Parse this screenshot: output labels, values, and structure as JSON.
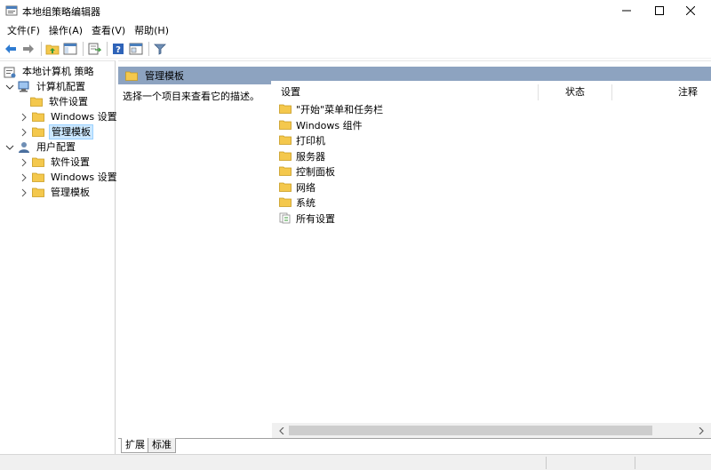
{
  "window": {
    "title": "本地组策略编辑器",
    "icons": {
      "app": "policy-editor-icon",
      "minimize": "minimize-icon",
      "maximize": "maximize-icon",
      "close": "close-icon"
    }
  },
  "menu": {
    "items": [
      {
        "label": "文件(F)"
      },
      {
        "label": "操作(A)"
      },
      {
        "label": "查看(V)"
      },
      {
        "label": "帮助(H)"
      }
    ]
  },
  "toolbar": {
    "buttons": [
      "back-arrow-icon",
      "forward-arrow-icon",
      "up-folder-icon",
      "show-hide-tree-icon",
      "export-list-icon",
      "help-icon",
      "properties-icon",
      "filter-icon"
    ]
  },
  "tree": {
    "root": {
      "label": "本地计算机 策略",
      "icon": "policy-icon"
    },
    "computer_config": {
      "label": "计算机配置",
      "icon": "computer-icon"
    },
    "computer_children": [
      {
        "label": "软件设置"
      },
      {
        "label": "Windows 设置"
      },
      {
        "label": "管理模板"
      }
    ],
    "user_config": {
      "label": "用户配置",
      "icon": "user-icon"
    },
    "user_children": [
      {
        "label": "软件设置"
      },
      {
        "label": "Windows 设置"
      },
      {
        "label": "管理模板"
      }
    ],
    "selected": "管理模板"
  },
  "main": {
    "header_title": "管理模板",
    "description": "选择一个项目来查看它的描述。",
    "columns": {
      "setting": "设置",
      "state": "状态",
      "comment": "注释"
    },
    "items": [
      {
        "label": "\"开始\"菜单和任务栏",
        "icon": "folder-icon"
      },
      {
        "label": "Windows 组件",
        "icon": "folder-icon"
      },
      {
        "label": "打印机",
        "icon": "folder-icon"
      },
      {
        "label": "服务器",
        "icon": "folder-icon"
      },
      {
        "label": "控制面板",
        "icon": "folder-icon"
      },
      {
        "label": "网络",
        "icon": "folder-icon"
      },
      {
        "label": "系统",
        "icon": "folder-icon"
      },
      {
        "label": "所有设置",
        "icon": "all-settings-icon"
      }
    ]
  },
  "tabs": [
    {
      "label": "扩展"
    },
    {
      "label": "标准"
    }
  ],
  "colors": {
    "header_bar": "#8da3c0",
    "selection": "#cce8ff",
    "folder": "#f4c84d"
  }
}
